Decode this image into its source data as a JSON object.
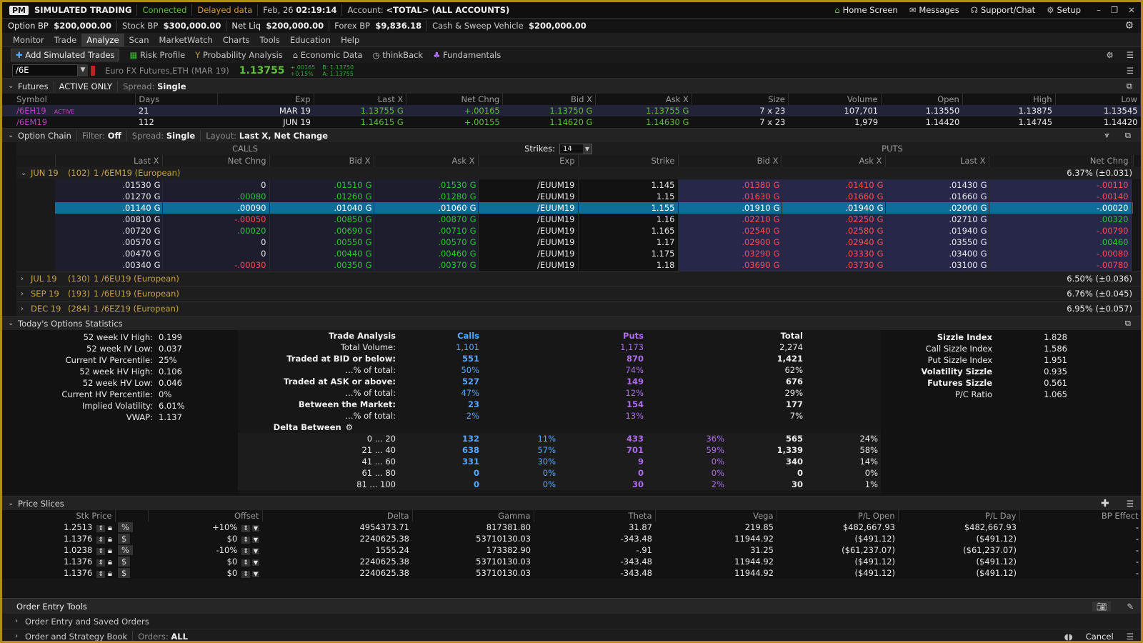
{
  "topbar": {
    "logo": "PM",
    "mode": "SIMULATED TRADING",
    "status": "Connected",
    "delayed": "Delayed data",
    "date": "Feb, 26",
    "time": "02:19:14",
    "account_label": "Account:",
    "account": "<TOTAL> (ALL ACCOUNTS)",
    "home": "Home Screen",
    "messages": "Messages",
    "support": "Support/Chat",
    "setup": "Setup"
  },
  "balances": {
    "option_bp_label": "Option BP",
    "option_bp": "$200,000.00",
    "stock_bp_label": "Stock BP",
    "stock_bp": "$300,000.00",
    "netliq_label": "Net Liq",
    "netliq": "$200,000.00",
    "forex_label": "Forex BP",
    "forex": "$9,836.18",
    "cash_label": "Cash & Sweep Vehicle",
    "cash": "$200,000.00"
  },
  "menu": [
    "Monitor",
    "Trade",
    "Analyze",
    "Scan",
    "MarketWatch",
    "Charts",
    "Tools",
    "Education",
    "Help"
  ],
  "subtabs": [
    "Add Simulated Trades",
    "Risk Profile",
    "Probability Analysis",
    "Economic Data",
    "thinkBack",
    "Fundamentals"
  ],
  "symbolbar": {
    "symbol": "/6E",
    "desc": "Euro FX Futures,ETH (MAR 19)",
    "price": "1.13755",
    "chg": "+.00165",
    "chgpct": "+0.15%",
    "bid": "B: 1.13750",
    "ask": "A: 1.13755"
  },
  "futures": {
    "label": "Futures",
    "filter": "ACTIVE ONLY",
    "spread_label": "Spread:",
    "spread": "Single",
    "headers": [
      "Symbol",
      "Days",
      "Exp",
      "Last X",
      "Net Chng",
      "Bid X",
      "Ask X",
      "Size",
      "Volume",
      "Open",
      "High",
      "Low"
    ],
    "rows": [
      [
        "/6EH19",
        "ACTIVE",
        "21",
        "MAR 19",
        "1.13755 G",
        "+.00165",
        "1.13750 G",
        "1.13755 G",
        "7 x 23",
        "107,701",
        "1.13550",
        "1.13875",
        "1.13545"
      ],
      [
        "/6EM19",
        "",
        "112",
        "JUN 19",
        "1.14615 G",
        "+.00155",
        "1.14620 G",
        "1.14630 G",
        "7 x 23",
        "1,979",
        "1.14420",
        "1.14745",
        "1.14420"
      ]
    ]
  },
  "chain": {
    "label": "Option Chain",
    "filter_label": "Filter:",
    "filter": "Off",
    "spread_label": "Spread:",
    "spread": "Single",
    "layout_label": "Layout:",
    "layout": "Last X, Net Change",
    "calls": "CALLS",
    "puts": "PUTS",
    "strikes_label": "Strikes:",
    "strikes": "14",
    "headers": [
      "Last X",
      "Net Chng",
      "Bid X",
      "Ask X",
      "Exp",
      "Strike",
      "Bid X",
      "Ask X",
      "Last X",
      "Net Chng"
    ],
    "exp_open": {
      "name": "JUN 19",
      "days": "(102)",
      "desc": "1 /6EM19 (European)",
      "iv": "6.37% (±0.031)"
    },
    "rows": [
      [
        ".01530",
        "0",
        ".01510",
        ".01530",
        "/EUUM19",
        "1.145",
        ".01380",
        ".01410",
        ".01430",
        "-.00110"
      ],
      [
        ".01270",
        ".00080",
        ".01260",
        ".01280",
        "/EUUM19",
        "1.15",
        ".01630",
        ".01660",
        ".01660",
        "-.00140"
      ],
      [
        ".01140",
        ".00090",
        ".01040",
        ".01060",
        "/EUUM19",
        "1.155",
        ".01910",
        ".01940",
        ".02060",
        "-.00020"
      ],
      [
        ".00810",
        "-.00050",
        ".00850",
        ".00870",
        "/EUUM19",
        "1.16",
        ".02210",
        ".02250",
        ".02710",
        ".00320"
      ],
      [
        ".00720",
        ".00020",
        ".00690",
        ".00710",
        "/EUUM19",
        "1.165",
        ".02540",
        ".02580",
        ".01940",
        "-.00790"
      ],
      [
        ".00570",
        "0",
        ".00550",
        ".00570",
        "/EUUM19",
        "1.17",
        ".02900",
        ".02940",
        ".03550",
        ".00460"
      ],
      [
        ".00470",
        "0",
        ".00440",
        ".00460",
        "/EUUM19",
        "1.175",
        ".03290",
        ".03330",
        ".03400",
        "-.00080"
      ],
      [
        ".00340",
        "-.00030",
        ".00350",
        ".00370",
        "/EUUM19",
        "1.18",
        ".03690",
        ".03730",
        ".03100",
        "-.00780"
      ]
    ],
    "exps": [
      {
        "name": "JUL 19",
        "days": "(130)",
        "desc": "1 /6EU19 (European)",
        "iv": "6.50% (±0.036)"
      },
      {
        "name": "SEP 19",
        "days": "(193)",
        "desc": "1 /6EU19 (European)",
        "iv": "6.76% (±0.045)"
      },
      {
        "name": "DEC 19",
        "days": "(284)",
        "desc": "1 /6EZ19 (European)",
        "iv": "6.95% (±0.057)"
      }
    ]
  },
  "stats": {
    "label": "Today's Options Statistics",
    "left": [
      [
        "52 week IV High:",
        "0.199"
      ],
      [
        "52 week IV Low:",
        "0.037"
      ],
      [
        "Current IV Percentile:",
        "25%"
      ],
      [
        "52 week HV High:",
        "0.106"
      ],
      [
        "52 week HV Low:",
        "0.046"
      ],
      [
        "Current HV Percentile:",
        "0%"
      ],
      [
        "Implied Volatility:",
        "6.01%"
      ],
      [
        "VWAP:",
        "1.137"
      ]
    ],
    "mid_header": [
      "Trade Analysis",
      "Calls",
      "Puts",
      "Total"
    ],
    "mid": [
      [
        "Total Volume:",
        "1,101",
        "1,173",
        "2,274",
        false
      ],
      [
        "Traded at BID or below:",
        "551",
        "870",
        "1,421",
        true
      ],
      [
        "...% of total:",
        "50%",
        "74%",
        "62%",
        false
      ],
      [
        "Traded at ASK or above:",
        "527",
        "149",
        "676",
        true
      ],
      [
        "...% of total:",
        "47%",
        "12%",
        "29%",
        false
      ],
      [
        "Between the Market:",
        "23",
        "154",
        "177",
        true
      ],
      [
        "...% of total:",
        "2%",
        "13%",
        "7%",
        false
      ]
    ],
    "delta_label": "Delta Between",
    "delta": [
      [
        "0 ... 20",
        "132",
        "11%",
        "433",
        "36%",
        "565",
        "24%"
      ],
      [
        "21 ... 40",
        "638",
        "57%",
        "701",
        "59%",
        "1,339",
        "58%"
      ],
      [
        "41 ... 60",
        "331",
        "30%",
        "9",
        "0%",
        "340",
        "14%"
      ],
      [
        "61 ... 80",
        "0",
        "0%",
        "0",
        "0%",
        "0",
        "0%"
      ],
      [
        "81 ... 100",
        "0",
        "0%",
        "30",
        "2%",
        "30",
        "1%"
      ]
    ],
    "right": [
      [
        "Sizzle Index",
        "1.828",
        true
      ],
      [
        "Call Sizzle Index",
        "1.586",
        false
      ],
      [
        "Put Sizzle Index",
        "1.951",
        false
      ],
      [
        "Volatility Sizzle",
        "0.935",
        true
      ],
      [
        "Futures Sizzle",
        "0.561",
        true
      ],
      [
        "P/C Ratio",
        "1.065",
        false
      ]
    ]
  },
  "slices": {
    "label": "Price Slices",
    "headers": [
      "Stk Price",
      "Offset",
      "Delta",
      "Gamma",
      "Theta",
      "Vega",
      "P/L Open",
      "P/L Day",
      "BP Effect"
    ],
    "rows": [
      [
        "1.2513",
        "%",
        "+10%",
        "4954373.71",
        "817381.80",
        "31.87",
        "219.85",
        "$482,667.93",
        "$482,667.93",
        "-"
      ],
      [
        "1.1376",
        "$",
        "$0",
        "2240625.38",
        "53710130.03",
        "-343.48",
        "11944.92",
        "($491.12)",
        "($491.12)",
        "-"
      ],
      [
        "1.0238",
        "%",
        "-10%",
        "1555.24",
        "173382.90",
        "-.91",
        "31.25",
        "($61,237.07)",
        "($61,237.07)",
        "-"
      ],
      [
        "1.1376",
        "$",
        "$0",
        "2240625.38",
        "53710130.03",
        "-343.48",
        "11944.92",
        "($491.12)",
        "($491.12)",
        "-"
      ],
      [
        "1.1376",
        "$",
        "$0",
        "2240625.38",
        "53710130.03",
        "-343.48",
        "11944.92",
        "($491.12)",
        "($491.12)",
        "-"
      ]
    ]
  },
  "bottom": {
    "order_entry": "Order Entry Tools",
    "saved": "Order Entry and Saved Orders",
    "book": "Order and Strategy Book",
    "orders_label": "Orders:",
    "orders": "ALL",
    "cancel": "Cancel"
  }
}
